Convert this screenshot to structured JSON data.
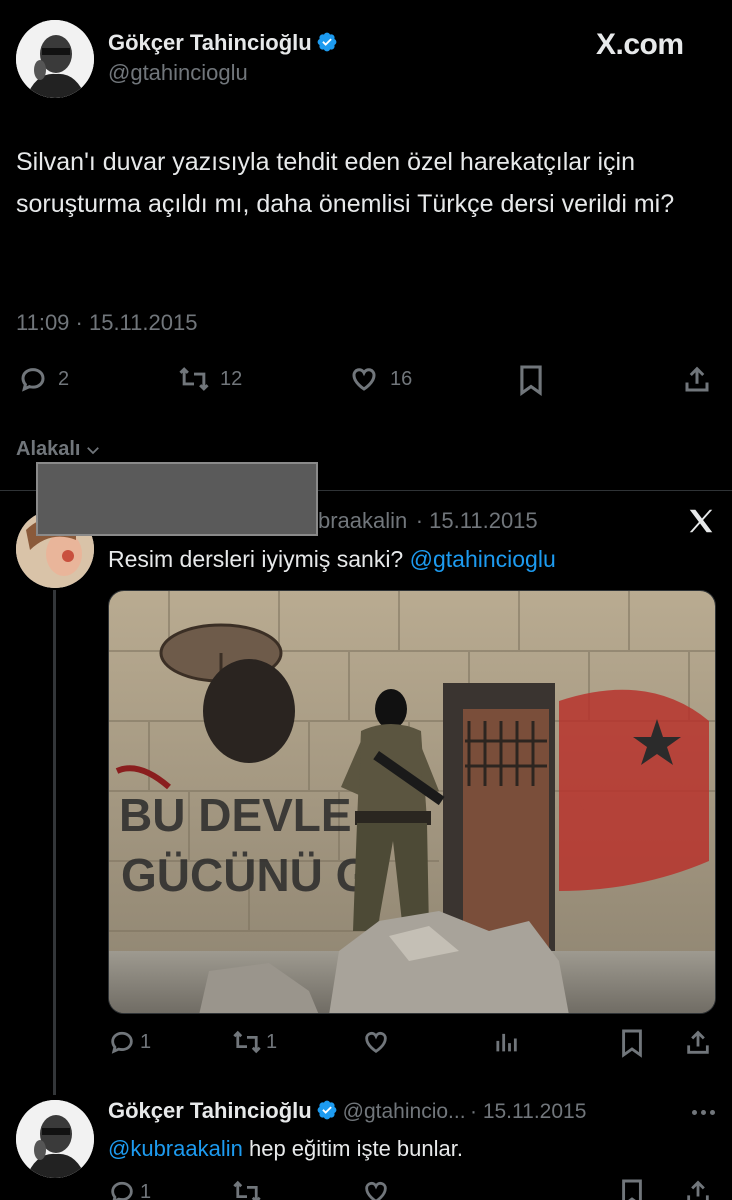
{
  "main_tweet": {
    "author_name": "Gökçer Tahincioğlu",
    "author_handle": "@gtahincioglu",
    "brand": "X.com",
    "text": "Silvan'ı duvar yazısıyla tehdit eden özel harekatçılar için soruşturma açıldı mı, daha önemlisi Türkçe dersi verildi mi?",
    "timestamp": "11:09 · 15.11.2015",
    "replies": "2",
    "retweets": "12",
    "likes": "16"
  },
  "sort_label": "Alakalı",
  "reply_1": {
    "handle_fragment": "braakalin",
    "date": "· 15.11.2015",
    "text": "Resim dersleri iyiymiş sanki?",
    "mention": "@gtahincioglu",
    "replies": "1",
    "retweets": "1"
  },
  "reply_2": {
    "author_name": "Gökçer Tahincioğlu",
    "author_handle": "@gtahincio...",
    "date": "· 15.11.2015",
    "mention": "@kubraakalin",
    "text": " hep eğitim işte bunlar.",
    "replies": "1"
  },
  "colors": {
    "background": "#000000",
    "text": "#e7e9ea",
    "muted": "#71767b",
    "accent": "#1d9bf0"
  }
}
